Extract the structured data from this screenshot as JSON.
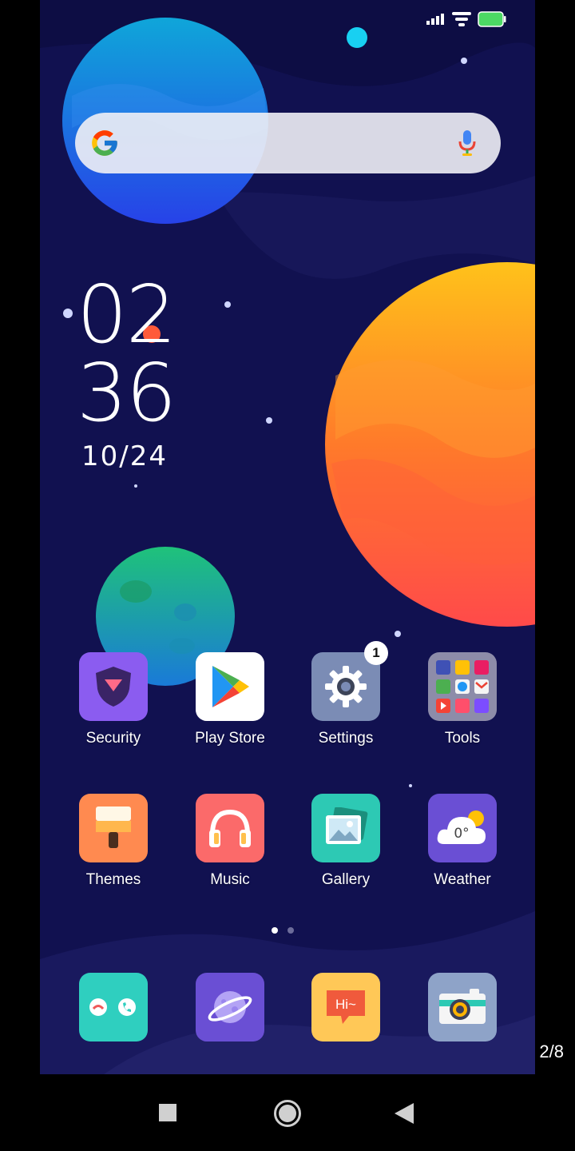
{
  "status_bar": {
    "signal_icon": "signal-bars-icon",
    "wifi_icon": "wifi-icon",
    "battery_icon": "battery-full-icon",
    "battery_color": "#4cd964"
  },
  "search_bar": {
    "logo_icon": "google-logo-icon",
    "mic_icon": "microphone-icon"
  },
  "clock_widget": {
    "hours": "02",
    "minutes": "36",
    "date": "10/24"
  },
  "apps_row1": [
    {
      "label": "Security",
      "icon": "shield-icon",
      "color": "#8b5cf0"
    },
    {
      "label": "Play Store",
      "icon": "play-store-icon",
      "color": "#ffffff"
    },
    {
      "label": "Settings",
      "icon": "gear-icon",
      "color": "#7b8cb5",
      "badge": "1"
    },
    {
      "label": "Tools",
      "icon": "folder-grid-icon",
      "color": "#8d8ca9"
    }
  ],
  "apps_row2": [
    {
      "label": "Themes",
      "icon": "paint-brush-icon",
      "color": "#ff8a50"
    },
    {
      "label": "Music",
      "icon": "headphones-icon",
      "color": "#fb6a6a"
    },
    {
      "label": "Gallery",
      "icon": "picture-icon",
      "color": "#2dc9b4"
    },
    {
      "label": "Weather",
      "icon": "cloud-icon",
      "color": "#6a4fd4",
      "value": "0°"
    }
  ],
  "page_indicator": {
    "current": 1,
    "total": 2
  },
  "dock": [
    {
      "name": "phone",
      "icon": "phone-call-icon",
      "color": "#2fcfbf"
    },
    {
      "name": "browser",
      "icon": "planet-icon",
      "color": "#6a4fd4"
    },
    {
      "name": "messages",
      "icon": "chat-bubble-icon",
      "color": "#ffc857",
      "text": "Hi~"
    },
    {
      "name": "camera",
      "icon": "camera-icon",
      "color": "#8ea3c8"
    }
  ],
  "nav_bar": {
    "recents_icon": "square-recents-icon",
    "home_icon": "circle-home-icon",
    "back_icon": "triangle-back-icon"
  },
  "page_counter": "2/8"
}
